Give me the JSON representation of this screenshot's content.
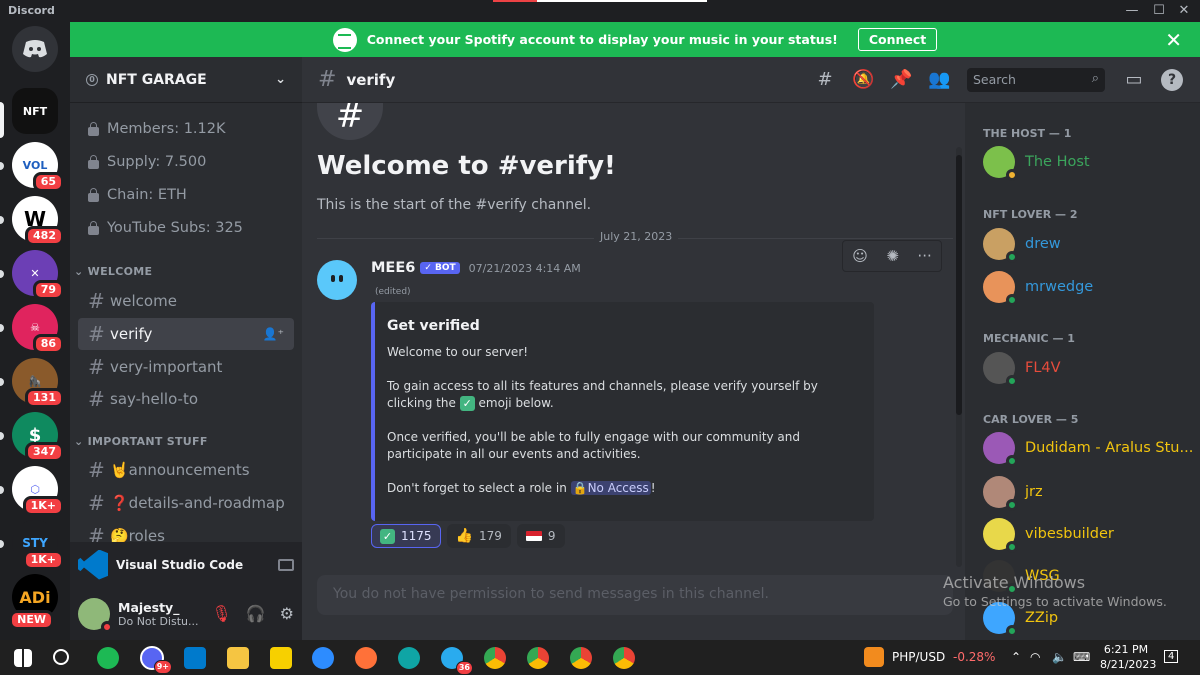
{
  "window": {
    "title": "Discord"
  },
  "banner": {
    "text": "Connect your Spotify account to display your music in your status!",
    "button": "Connect"
  },
  "servers": [
    {
      "badge": ""
    },
    {
      "badge": "65"
    },
    {
      "badge": "482"
    },
    {
      "badge": "79"
    },
    {
      "badge": "86"
    },
    {
      "badge": "131"
    },
    {
      "badge": "347"
    },
    {
      "badge": "1K+"
    },
    {
      "badge": "1K+"
    },
    {
      "badge": "NEW"
    }
  ],
  "sidebar": {
    "server_name": "NFT GARAGE",
    "boost_count": "0",
    "stats": [
      "Members: 1.12K",
      "Supply: 7.500",
      "Chain: ETH",
      "YouTube Subs: 325"
    ],
    "categories": [
      "WELCOME",
      "IMPORTANT STUFF"
    ],
    "channels": [
      "welcome",
      "verify",
      "very-important",
      "say-hello-to",
      "🤘announcements",
      "❓details-and-roadmap",
      "🤔roles"
    ],
    "activity": {
      "app": "Visual Studio Code"
    },
    "user": {
      "name": "Majesty_",
      "status": "Do Not Distu..."
    }
  },
  "chat": {
    "channel": "verify",
    "welcome_title": "Welcome to #verify!",
    "welcome_sub": "This is the start of the #verify channel.",
    "date_divider": "July 21, 2023",
    "message": {
      "author": "MEE6",
      "bot_label": "✓ BOT",
      "timestamp": "07/21/2023 4:14 AM",
      "edited": "(edited)",
      "embed": {
        "title": "Get verified",
        "line1": "Welcome to our server!",
        "line2a": "To gain access to all its features and channels, please verify yourself by clicking the",
        "line2b": "emoji below.",
        "line3": "Once verified, you'll be able to fully engage with our community and participate in all our events and activities.",
        "line4a": "Don't forget to select a role in",
        "role": "🔒No Access",
        "line4b": "!"
      },
      "reactions": [
        {
          "emoji": "✅",
          "count": "1175"
        },
        {
          "emoji": "👍",
          "count": "179"
        },
        {
          "emoji": "flag",
          "count": "9"
        }
      ]
    },
    "input_placeholder": "You do not have permission to send messages in this channel."
  },
  "search": {
    "placeholder": "Search"
  },
  "members": {
    "groups": [
      {
        "title": "THE HOST — 1",
        "members": [
          "The Host"
        ]
      },
      {
        "title": "NFT LOVER — 2",
        "members": [
          "drew",
          "mrwedge"
        ]
      },
      {
        "title": "MECHANIC — 1",
        "members": [
          "FL4V"
        ]
      },
      {
        "title": "CAR LOVER — 5",
        "members": [
          "Dudidam - Aralus Stu...",
          "jrz",
          "vibesbuilder",
          "WSG",
          "ZZip"
        ]
      }
    ]
  },
  "watermark": {
    "line1": "Activate Windows",
    "line2": "Go to Settings to activate Windows."
  },
  "taskbar": {
    "currency": "PHP/USD",
    "change": "-0.28%",
    "time": "6:21 PM",
    "date": "8/21/2023",
    "notif": "4",
    "badge_discord": "9+",
    "badge_telegram": "36"
  },
  "colors": {
    "spotify": "#1db954",
    "blurple": "#5865f2",
    "host": "#3ba55c",
    "nft_lover": "#3498db",
    "mechanic": "#e74c3c",
    "car_lover": "#f1c40f"
  }
}
